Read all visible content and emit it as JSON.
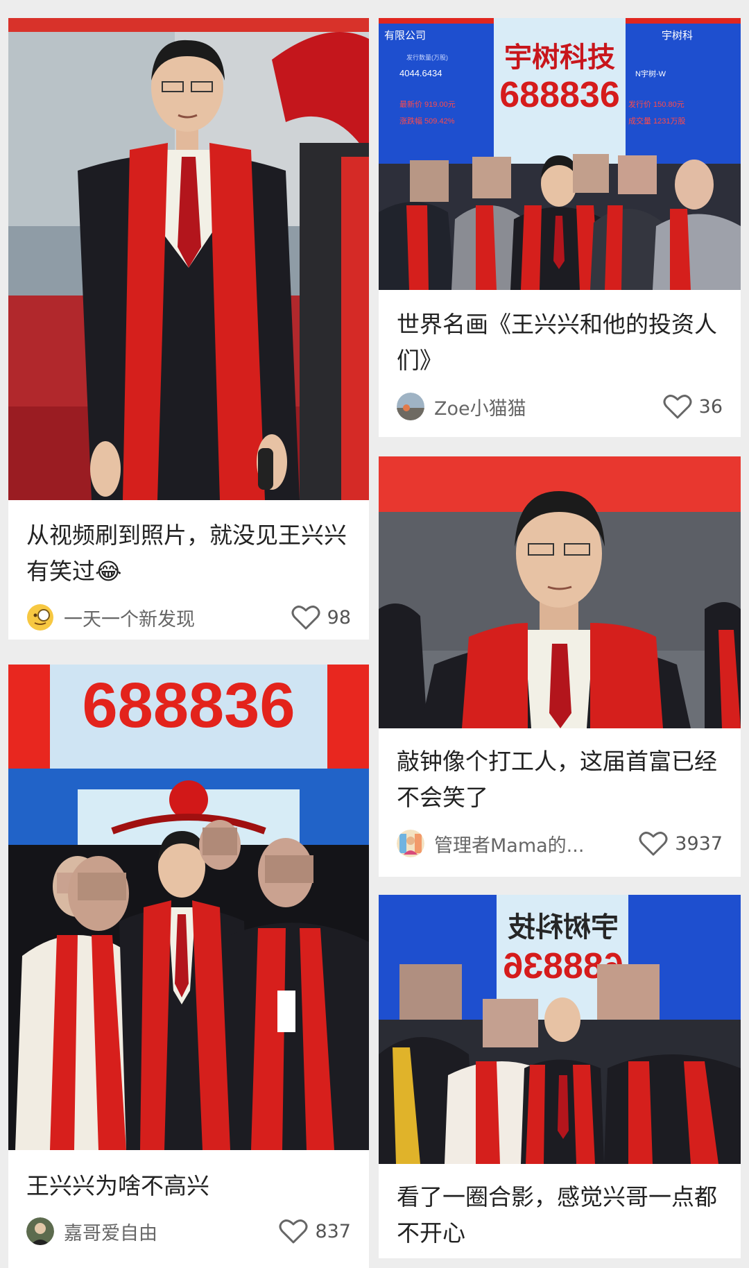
{
  "feed": {
    "posts": [
      {
        "title": "从视频刷到照片，就没见王兴兴有笑过😂",
        "author": "一天一个新发现",
        "likes": "98",
        "avatar_icon": "magnifier-face-emoji-icon"
      },
      {
        "title": "世界名画《王兴兴和他的投资人们》",
        "author": "Zoe小猫猫",
        "likes": "36",
        "avatar_icon": "photo-avatar-icon",
        "board": {
          "company": "宇树科技",
          "code": "688836",
          "header_left": "有限公司",
          "header_right": "宇树科",
          "stat1_label": "发行数量(万股)",
          "stat1_value": "4044.6434",
          "stat2": "最新价 919.00元",
          "stat3": "涨跌幅 509.42%",
          "right_name": "N宇树-W",
          "right_stat1": "发行价 150.80元",
          "right_stat2": "成交量 1231万股"
        }
      },
      {
        "title": "敲钟像个打工人，这届首富已经不会笑了",
        "author": "管理者Mama的...",
        "likes": "3937",
        "avatar_icon": "cartoon-avatar-icon"
      },
      {
        "title": "王兴兴为啥不高兴",
        "author": "嘉哥爱自由",
        "likes": "837",
        "avatar_icon": "portrait-avatar-icon",
        "board": {
          "code": "688836"
        }
      },
      {
        "title": "看了一圈合影，感觉兴哥一点都不开心",
        "author": "",
        "likes": "",
        "board": {
          "company_mirrored": "宇树科技",
          "code_mirrored": "688836"
        }
      }
    ]
  },
  "colors": {
    "red": "#e8271f",
    "blue": "#1e5bd8",
    "suit": "#1c1c22",
    "skin": "#e7c2a4"
  }
}
